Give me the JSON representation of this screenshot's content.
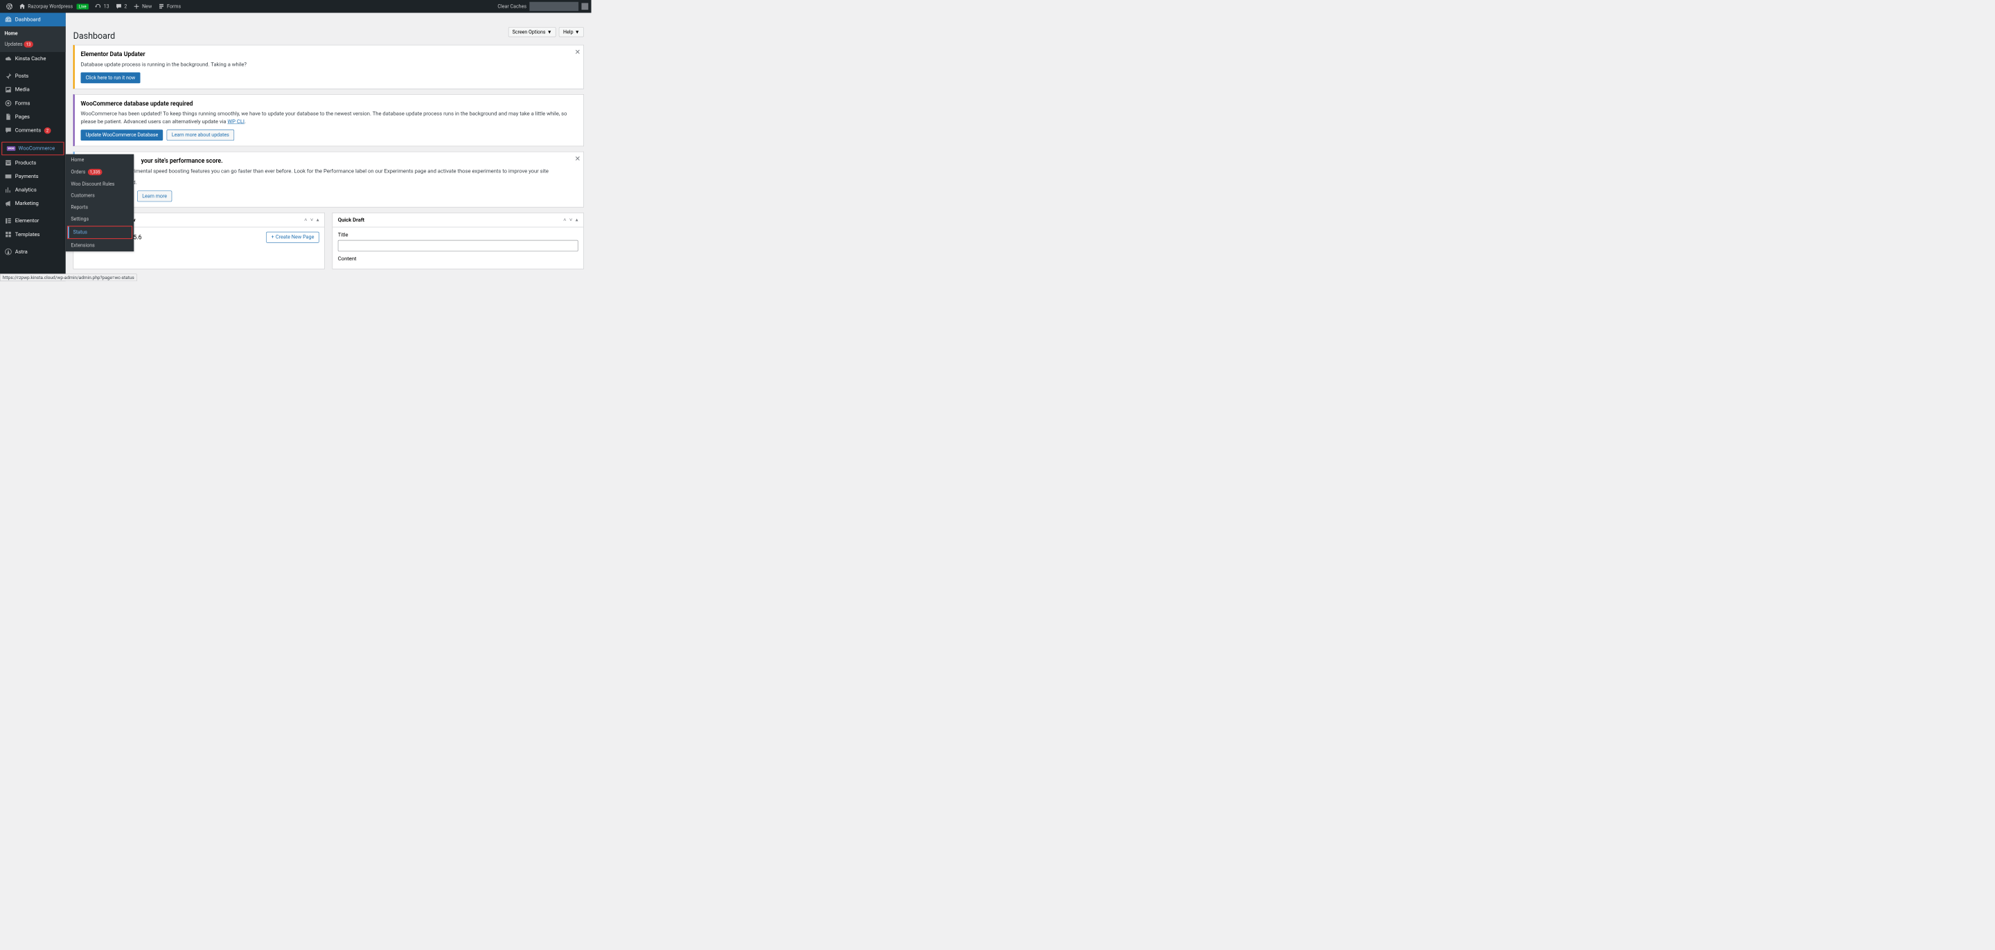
{
  "adminbar": {
    "site_name": "Razorpay Wordpress",
    "live": "Live",
    "updates": "13",
    "comments": "2",
    "new": "New",
    "forms": "Forms",
    "clear_caches": "Clear Caches"
  },
  "sidebar": {
    "dashboard": "Dashboard",
    "home": "Home",
    "updates": "Updates",
    "updates_badge": "13",
    "kinsta": "Kinsta Cache",
    "posts": "Posts",
    "media": "Media",
    "forms": "Forms",
    "pages": "Pages",
    "comments": "Comments",
    "comments_badge": "2",
    "woocommerce": "WooCommerce",
    "products": "Products",
    "payments": "Payments",
    "analytics": "Analytics",
    "marketing": "Marketing",
    "elementor": "Elementor",
    "templates": "Templates",
    "astra": "Astra"
  },
  "flyout": {
    "home": "Home",
    "orders": "Orders",
    "orders_badge": "1,335",
    "woo_discount": "Woo Discount Rules",
    "customers": "Customers",
    "reports": "Reports",
    "settings": "Settings",
    "status": "Status",
    "extensions": "Extensions"
  },
  "top_buttons": {
    "screen_options": "Screen Options",
    "help": "Help"
  },
  "page_title": "Dashboard",
  "notices": {
    "elementor_updater": {
      "title": "Elementor Data Updater",
      "body": "Database update process is running in the background. Taking a while?",
      "button": "Click here to run it now"
    },
    "wc_update": {
      "title": "WooCommerce database update required",
      "body_a": "WooCommerce has been updated! To keep things running smoothly, we have to update your database to the newest version. The database update process runs in the background and may take a little while, so please be patient. Advanced users can alternatively update via ",
      "link": "WP CLI",
      "body_b": ".",
      "btn_primary": "Update WooCommerce Database",
      "btn_secondary": "Learn more about updates"
    },
    "perf": {
      "title_suffix": "your site's performance score.",
      "body_suffix": "erimental speed boosting features you can go faster than ever before. Look for the Performance label on our Experiments page and activate those experiments to improve your site",
      "body_end": "ed.",
      "learn": "Learn more"
    }
  },
  "overview": {
    "elementor_ver": "Elementor v3.25.6",
    "create": "Create New Page"
  },
  "quick_draft": {
    "heading": "Quick Draft",
    "title_label": "Title",
    "content_label": "Content"
  },
  "status_url": "https://rzpwp.kinsta.cloud/wp-admin/admin.php?page=wc-status"
}
